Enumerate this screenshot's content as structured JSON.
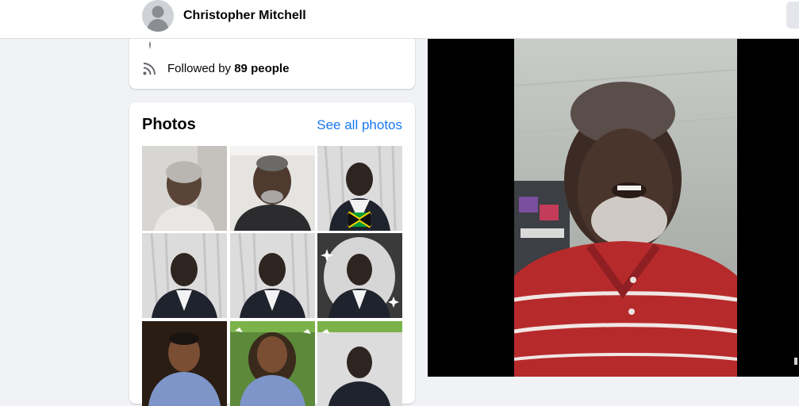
{
  "header": {
    "profile_name": "Christopher Mitchell",
    "avatar_icon": "default-avatar-icon"
  },
  "intro": {
    "followed_prefix": "Followed by ",
    "followed_count": "89 people",
    "rss_icon": "rss-icon"
  },
  "photos": {
    "title": "Photos",
    "see_all_label": "See all photos"
  },
  "colors": {
    "link": "#1877f2",
    "background": "#f0f2f5",
    "viewer": "#000000"
  }
}
